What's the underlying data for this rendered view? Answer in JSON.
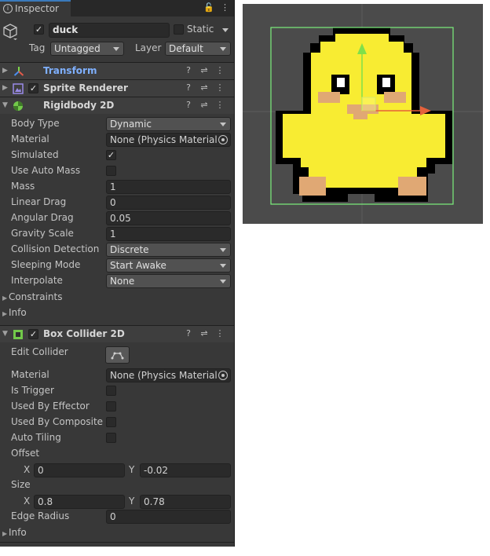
{
  "window": {
    "tab_title": "Inspector"
  },
  "object": {
    "name": "duck",
    "static_label": "Static",
    "tag_label": "Tag",
    "tag_value": "Untagged",
    "layer_label": "Layer",
    "layer_value": "Default"
  },
  "components": {
    "transform": {
      "name": "Transform"
    },
    "sprite_renderer": {
      "name": "Sprite Renderer"
    },
    "rigidbody2d": {
      "name": "Rigidbody 2D"
    },
    "box_collider2d": {
      "name": "Box Collider 2D"
    }
  },
  "rigidbody": {
    "body_type": {
      "label": "Body Type",
      "value": "Dynamic"
    },
    "material": {
      "label": "Material",
      "value": "None (Physics Material"
    },
    "simulated": {
      "label": "Simulated",
      "checked": true
    },
    "use_auto_mass": {
      "label": "Use Auto Mass",
      "checked": false
    },
    "mass": {
      "label": "Mass",
      "value": "1"
    },
    "linear_drag": {
      "label": "Linear Drag",
      "value": "0"
    },
    "angular_drag": {
      "label": "Angular Drag",
      "value": "0.05"
    },
    "gravity_scale": {
      "label": "Gravity Scale",
      "value": "1"
    },
    "collision_detection": {
      "label": "Collision Detection",
      "value": "Discrete"
    },
    "sleeping_mode": {
      "label": "Sleeping Mode",
      "value": "Start Awake"
    },
    "interpolate": {
      "label": "Interpolate",
      "value": "None"
    },
    "constraints": {
      "label": "Constraints"
    },
    "info": {
      "label": "Info"
    }
  },
  "collider": {
    "edit_collider": {
      "label": "Edit Collider"
    },
    "material": {
      "label": "Material",
      "value": "None (Physics Material"
    },
    "is_trigger": {
      "label": "Is Trigger",
      "checked": false
    },
    "used_by_effector": {
      "label": "Used By Effector",
      "checked": false
    },
    "used_by_composite": {
      "label": "Used By Composite",
      "checked": false
    },
    "auto_tiling": {
      "label": "Auto Tiling",
      "checked": false
    },
    "offset": {
      "label": "Offset",
      "x_label": "X",
      "x": "0",
      "y_label": "Y",
      "y": "-0.02"
    },
    "size": {
      "label": "Size",
      "x_label": "X",
      "x": "0.8",
      "y_label": "Y",
      "y": "0.78"
    },
    "edge_radius": {
      "label": "Edge Radius",
      "value": "0"
    },
    "info": {
      "label": "Info"
    }
  },
  "icons": {
    "lock": "lock-icon",
    "menu": "kebab-menu-icon",
    "help": "help-icon",
    "preset": "preset-sliders-icon"
  },
  "colors": {
    "panel": "#383838",
    "scene": "#4b4b4b",
    "duck_body": "#f8ec32",
    "duck_beak": "#e0a874",
    "collider": "#7cf17c",
    "transform_name": "#7fb0ff"
  }
}
